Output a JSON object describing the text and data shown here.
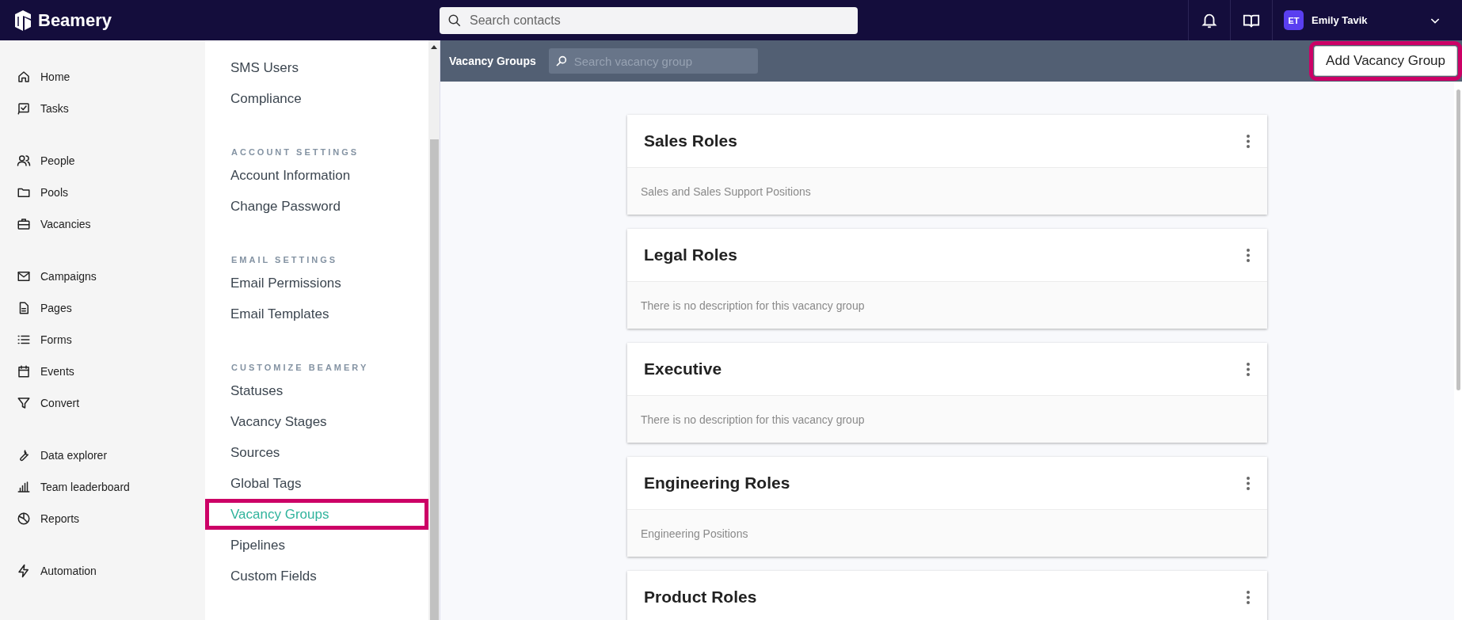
{
  "topbar": {
    "logo": "Beamery",
    "search": {
      "placeholder": "Search contacts"
    },
    "user": {
      "initials": "ET",
      "name": "Emily Tavik"
    }
  },
  "nav": {
    "groups": [
      {
        "items": [
          {
            "label": "Home"
          },
          {
            "label": "Tasks"
          }
        ]
      },
      {
        "items": [
          {
            "label": "People"
          },
          {
            "label": "Pools"
          },
          {
            "label": "Vacancies"
          }
        ]
      },
      {
        "items": [
          {
            "label": "Campaigns"
          },
          {
            "label": "Pages"
          },
          {
            "label": "Forms"
          },
          {
            "label": "Events"
          },
          {
            "label": "Convert"
          }
        ]
      },
      {
        "items": [
          {
            "label": "Data explorer"
          },
          {
            "label": "Team leaderboard"
          },
          {
            "label": "Reports"
          }
        ]
      },
      {
        "items": [
          {
            "label": "Automation"
          }
        ]
      }
    ]
  },
  "settings_menu": {
    "sections": [
      {
        "items": [
          {
            "label": "SMS Users",
            "selected": false,
            "highlighted": false
          },
          {
            "label": "Compliance",
            "selected": false,
            "highlighted": false
          }
        ]
      },
      {
        "heading": "ACCOUNT SETTINGS",
        "items": [
          {
            "label": "Account Information",
            "selected": false,
            "highlighted": false
          },
          {
            "label": "Change Password",
            "selected": false,
            "highlighted": false
          }
        ]
      },
      {
        "heading": "EMAIL SETTINGS",
        "items": [
          {
            "label": "Email Permissions",
            "selected": false,
            "highlighted": false
          },
          {
            "label": "Email Templates",
            "selected": false,
            "highlighted": false
          }
        ]
      },
      {
        "heading": "CUSTOMIZE BEAMERY",
        "items": [
          {
            "label": "Statuses",
            "selected": false,
            "highlighted": false
          },
          {
            "label": "Vacancy Stages",
            "selected": false,
            "highlighted": false
          },
          {
            "label": "Sources",
            "selected": false,
            "highlighted": false
          },
          {
            "label": "Global Tags",
            "selected": false,
            "highlighted": false
          },
          {
            "label": "Vacancy Groups",
            "selected": true,
            "highlighted": true
          },
          {
            "label": "Pipelines",
            "selected": false,
            "highlighted": false
          },
          {
            "label": "Custom Fields",
            "selected": false,
            "highlighted": false
          }
        ]
      }
    ]
  },
  "toolbar": {
    "title": "Vacancy Groups",
    "search": {
      "placeholder": "Search vacancy group"
    },
    "add_button": {
      "label": "Add Vacancy Group",
      "highlighted": true
    }
  },
  "vacancy_groups": [
    {
      "name": "Sales Roles",
      "description": "Sales and Sales Support Positions"
    },
    {
      "name": "Legal Roles",
      "description": "There is no description for this vacancy group"
    },
    {
      "name": "Executive",
      "description": "There is no description for this vacancy group"
    },
    {
      "name": "Engineering Roles",
      "description": "Engineering Positions"
    },
    {
      "name": "Product Roles"
    }
  ]
}
